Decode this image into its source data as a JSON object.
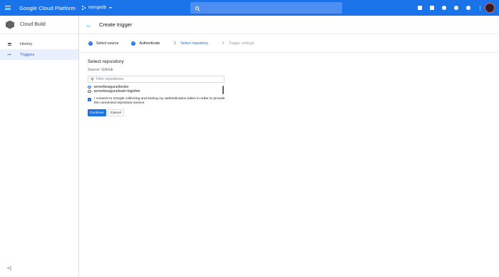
{
  "topbar": {
    "brand": "Google Cloud Platform",
    "project": "mongodb",
    "icons": [
      "apps-icon",
      "terminal-icon",
      "feedback-icon",
      "help-icon",
      "notifications-icon",
      "more-vert-icon"
    ]
  },
  "sidebar": {
    "title": "Cloud Build",
    "items": [
      {
        "label": "History",
        "icon": "list-icon"
      },
      {
        "label": "Triggers",
        "icon": "triggers-icon"
      }
    ],
    "collapse_glyph": "<|"
  },
  "header": {
    "title": "Create trigger"
  },
  "steps": [
    {
      "label": "Select source",
      "state": "done"
    },
    {
      "label": "Authenticate",
      "state": "done"
    },
    {
      "number": "3",
      "label": "Select repository",
      "state": "current"
    },
    {
      "number": "4",
      "label": "Trigger settings",
      "state": "pending"
    }
  ],
  "form": {
    "section_title": "Select repository",
    "source": "Source: GitHub",
    "filter_placeholder": "Filter repositories",
    "repos": [
      {
        "name": "serverlessguru/docker",
        "selected": true
      },
      {
        "name": "serverlessguru/team-together",
        "selected": false
      }
    ],
    "consent": "I consent to Google collecting and storing my authentication token in order to provide the connected repository service",
    "continue_label": "Continue",
    "cancel_label": "Cancel"
  },
  "colors": {
    "accent": "#1a73e8",
    "active_nav_bg": "#e8f0fe"
  }
}
